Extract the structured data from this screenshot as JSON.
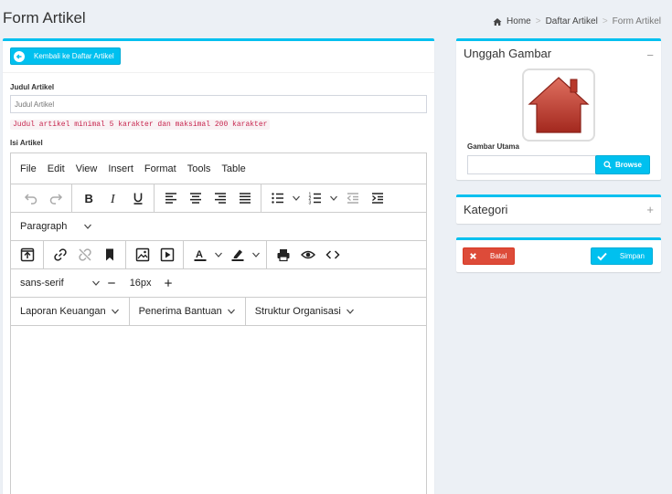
{
  "header": {
    "title": "Form Artikel",
    "breadcrumb": [
      "Home",
      "Daftar Artikel",
      "Form Artikel"
    ]
  },
  "form": {
    "back_label": "Kembali ke Daftar Artikel",
    "judul_label": "Judul Artikel",
    "judul_placeholder": "Judul Artikel",
    "judul_value": "",
    "judul_hint": "Judul artikel minimal 5 karakter dan maksimal 200 karakter",
    "isi_label": "Isi Artikel"
  },
  "editor": {
    "menu": [
      "File",
      "Edit",
      "View",
      "Insert",
      "Format",
      "Tools",
      "Table"
    ],
    "block_format": "Paragraph",
    "font_family": "sans-serif",
    "font_size": "16px",
    "custom_menus": [
      "Laporan Keuangan",
      "Penerima Bantuan",
      "Struktur Organisasi"
    ]
  },
  "upload": {
    "title": "Unggah Gambar",
    "collapse_symbol": "−",
    "field_label": "Gambar Utama",
    "browse_label": "Browse"
  },
  "kategori": {
    "title": "Kategori",
    "expand_symbol": "+"
  },
  "actions": {
    "cancel_label": "Batal",
    "save_label": "Simpan"
  },
  "colors": {
    "accent": "#00c0ef",
    "danger": "#dd4b39",
    "background": "#ecf0f5",
    "placeholder_image": "#b03a2e"
  }
}
